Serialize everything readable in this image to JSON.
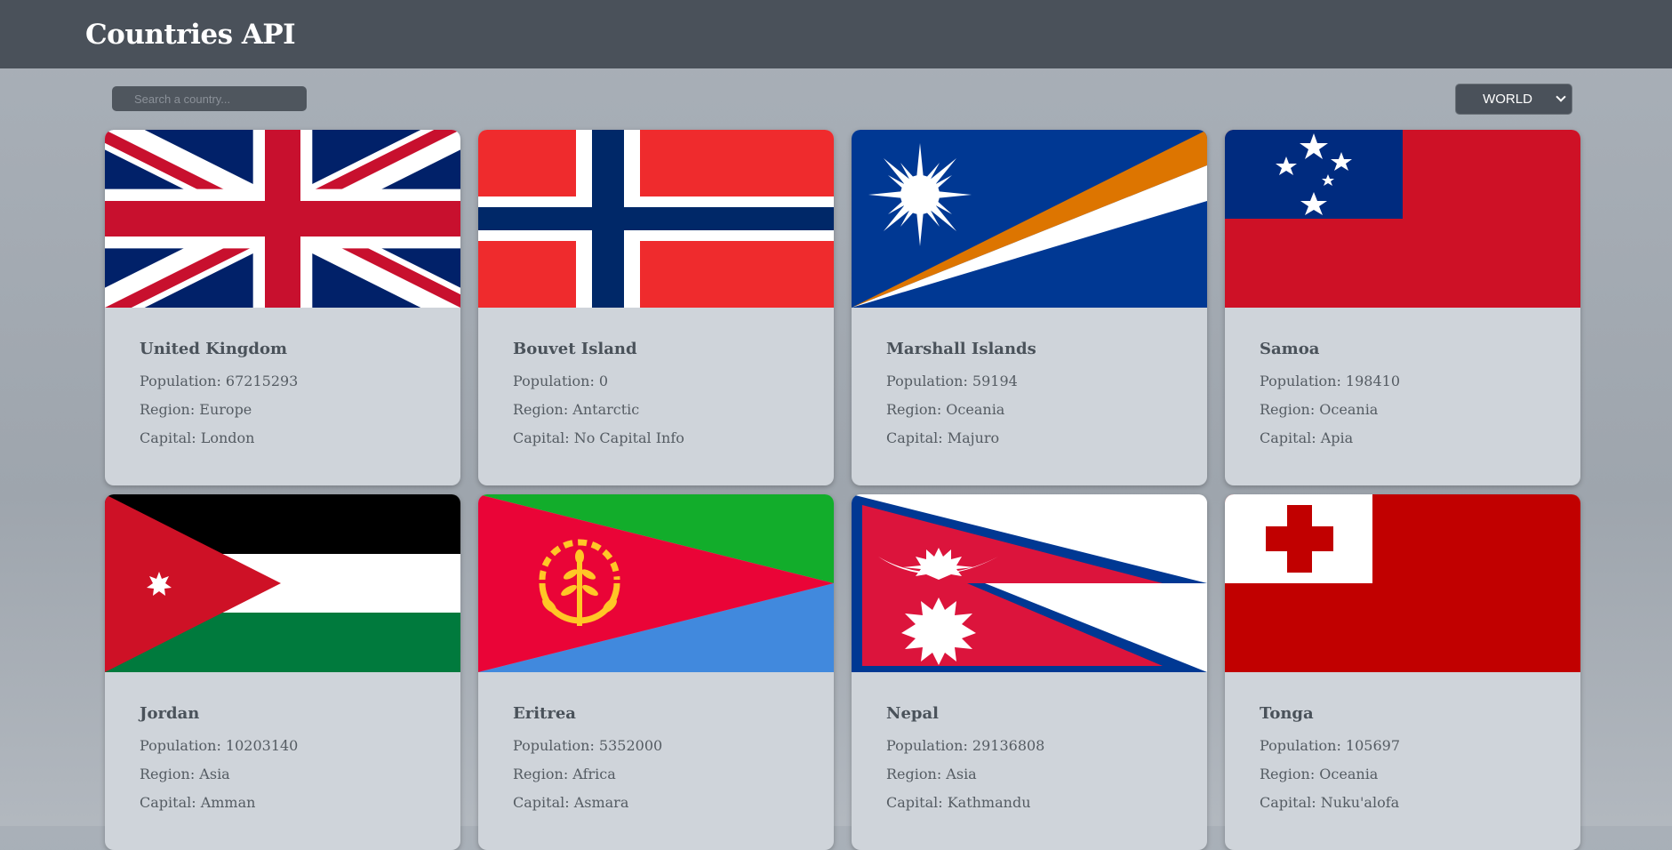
{
  "header": {
    "title": "Countries API"
  },
  "controls": {
    "search_placeholder": "Search a country...",
    "region_selected": "WORLD"
  },
  "labels": {
    "population": "Population: ",
    "region": "Region: ",
    "capital": "Capital: "
  },
  "countries": [
    {
      "name": "United Kingdom",
      "population": "67215293",
      "region": "Europe",
      "capital": "London"
    },
    {
      "name": "Bouvet Island",
      "population": "0",
      "region": "Antarctic",
      "capital": "No Capital Info"
    },
    {
      "name": "Marshall Islands",
      "population": "59194",
      "region": "Oceania",
      "capital": "Majuro"
    },
    {
      "name": "Samoa",
      "population": "198410",
      "region": "Oceania",
      "capital": "Apia"
    },
    {
      "name": "Jordan",
      "population": "10203140",
      "region": "Asia",
      "capital": "Amman"
    },
    {
      "name": "Eritrea",
      "population": "5352000",
      "region": "Africa",
      "capital": "Asmara"
    },
    {
      "name": "Nepal",
      "population": "29136808",
      "region": "Asia",
      "capital": "Kathmandu"
    },
    {
      "name": "Tonga",
      "population": "105697",
      "region": "Oceania",
      "capital": "Nuku'alofa"
    }
  ]
}
